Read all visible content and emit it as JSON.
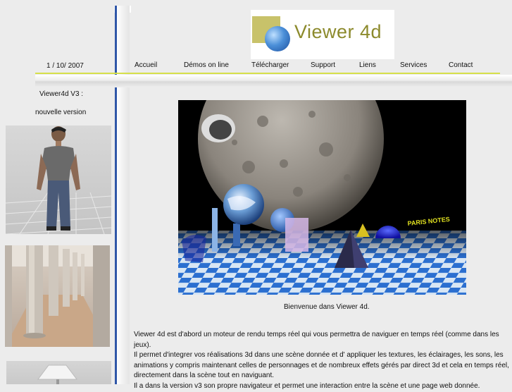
{
  "header": {
    "logo_text": "Viewer 4d",
    "date": "1 / 10/ 2007"
  },
  "nav": {
    "items": [
      {
        "label": "Accueil"
      },
      {
        "label": "Démos on line"
      },
      {
        "label": "Télécharger"
      },
      {
        "label": "Support"
      },
      {
        "label": "Liens"
      },
      {
        "label": "Services"
      },
      {
        "label": "Contact"
      }
    ]
  },
  "sidebar": {
    "title": "Viewer4d V3 :",
    "subtitle": "nouvelle version"
  },
  "main": {
    "caption": "Bienvenue dans Viewer 4d.",
    "paragraphs": [
      "Viewer 4d est d'abord un moteur de rendu temps réel qui vous permettra de naviguer en temps réel (comme dans les jeux).",
      "Il permet d'integrer vos réalisations 3d dans une scène donnée et d' appliquer les textures, les éclairages, les sons, les animations y compris maintenant celles de personnages et de nombreux effets gérés par direct 3d et cela en temps réel, directement dans la scène tout en naviguant.",
      "Il a dans la version v3 son propre navigateur et permet une interaction entre la scène et une page web donnée."
    ],
    "scene_sign": "PARIS NOTES"
  },
  "colors": {
    "accent_line": "#d6e04a",
    "vertical_line": "#2f57a8",
    "logo_text": "#8c8a2c"
  }
}
